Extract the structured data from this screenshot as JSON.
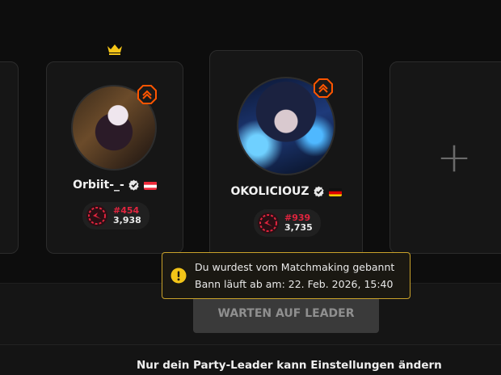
{
  "party": {
    "members": [
      {
        "name": "Orbiit-_-",
        "rank": "#454",
        "elo": "3,938",
        "country": "Austria",
        "is_leader": true,
        "verified": true
      },
      {
        "name": "OKOLICIOUZ",
        "rank": "#939",
        "elo": "3,735",
        "country": "Germany",
        "is_leader": false,
        "verified": true
      }
    ],
    "empty_slot_symbol": "+"
  },
  "ban_notice": {
    "line1": "Du wurdest vom Matchmaking gebannt",
    "line2": "Bann läuft ab am: 22. Feb. 2026, 15:40"
  },
  "wait_button_label": "WARTEN AUF LEADER",
  "footer_text": "Nur dein Party-Leader kann Einstellungen ändern",
  "colors": {
    "background": "#0d0d0d",
    "card": "#161616",
    "accent_orange": "#ff5500",
    "crown_yellow": "#f5c518",
    "rank_red": "#e0243e",
    "tooltip_border": "#c9a22a"
  },
  "icons": [
    "crown-icon",
    "rank-chevron-icon",
    "verified-icon",
    "elo-icon",
    "warning-icon",
    "plus-icon"
  ]
}
